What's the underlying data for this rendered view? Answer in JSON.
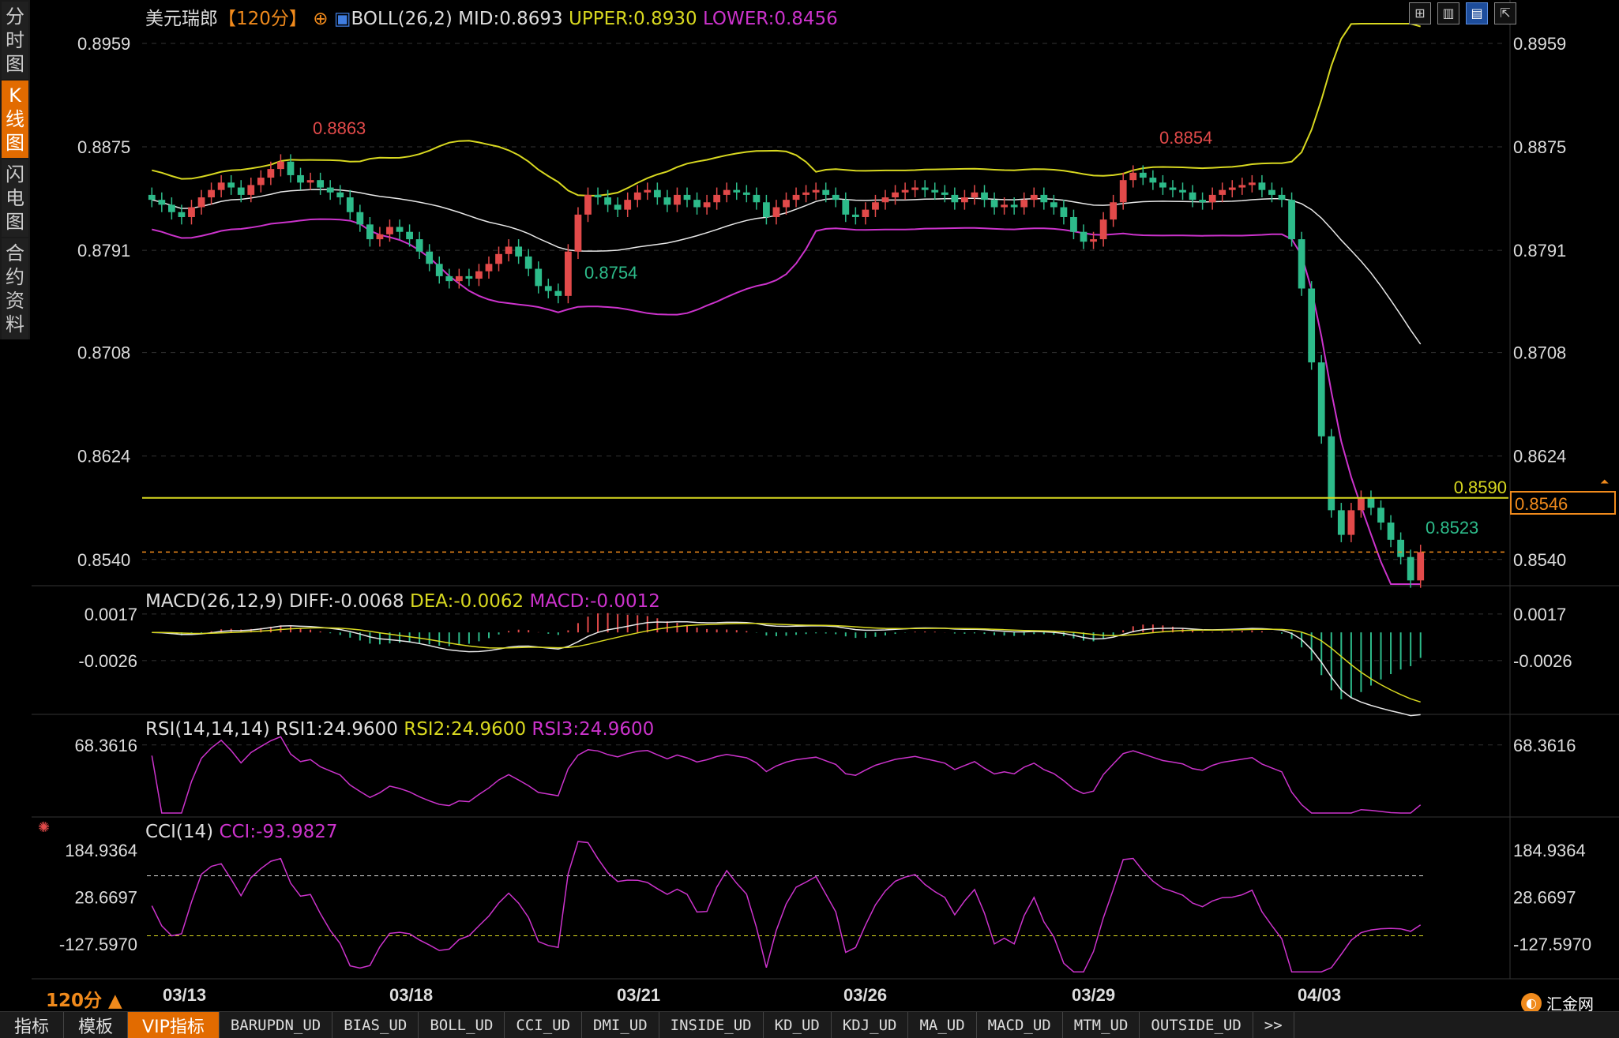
{
  "header": {
    "instrument": "美元瑞郎",
    "period_bracket": "【120分】",
    "indicator_main": "BOLL(26,2)",
    "mid": "MID:0.8693",
    "upper": "UPPER:0.8930",
    "lower": "LOWER:0.8456"
  },
  "sidebar_tabs": [
    "分时图",
    "K线图",
    "闪电图",
    "合约资料"
  ],
  "sidebar_active": 1,
  "toolbar_icons": [
    "grid-icon",
    "bar-chart-icon",
    "candle-icon",
    "expand-icon"
  ],
  "price_axis": {
    "ticks": [
      "0.8959",
      "0.8875",
      "0.8791",
      "0.8708",
      "0.8624",
      "0.8540"
    ],
    "range": [
      0.852,
      0.8975
    ],
    "current_price": "0.8546",
    "line_label": "0.8590"
  },
  "annotations": {
    "high1": "0.8863",
    "high2": "0.8854",
    "low1": "0.8754",
    "low2": "0.8523"
  },
  "macd": {
    "label": "MACD(26,12,9)",
    "diff": "DIFF:-0.0068",
    "dea": "DEA:-0.0062",
    "macd": "MACD:-0.0012",
    "ticks": [
      "0.0017",
      "-0.0026"
    ]
  },
  "rsi": {
    "label": "RSI(14,14,14)",
    "rsi1": "RSI1:24.9600",
    "rsi2": "RSI2:24.9600",
    "rsi3": "RSI3:24.9600",
    "ticks": [
      "68.3616"
    ]
  },
  "cci": {
    "label": "CCI(14)",
    "value": "CCI:-93.9827",
    "ticks": [
      "184.9364",
      "28.6697",
      "-127.5970"
    ]
  },
  "dates": [
    "03/13",
    "03/18",
    "03/21",
    "03/26",
    "03/29",
    "04/03"
  ],
  "period_label": "120分",
  "bottom_tabs": [
    "指标",
    "模板",
    "VIP指标",
    "BARUPDN_UD",
    "BIAS_UD",
    "BOLL_UD",
    "CCI_UD",
    "DMI_UD",
    "INSIDE_UD",
    "KD_UD",
    "KDJ_UD",
    "MA_UD",
    "MACD_UD",
    "MTM_UD",
    "OUTSIDE_UD",
    ">>"
  ],
  "bottom_active": 2,
  "logo_text": "汇金网",
  "colors": {
    "up": "#e24a4a",
    "down": "#2dbb8a",
    "upper": "#d8d820",
    "lower": "#cc33cc",
    "mid": "#e8e8e8",
    "accent": "#f08a1c"
  },
  "chart_data": {
    "type": "candlestick",
    "close_series": [
      0.8832,
      0.8828,
      0.8822,
      0.8818,
      0.8826,
      0.8834,
      0.884,
      0.8846,
      0.8842,
      0.8836,
      0.8844,
      0.885,
      0.8857,
      0.8863,
      0.8852,
      0.8846,
      0.8848,
      0.8842,
      0.8838,
      0.8834,
      0.8822,
      0.8812,
      0.88,
      0.8804,
      0.881,
      0.8806,
      0.88,
      0.879,
      0.878,
      0.877,
      0.8766,
      0.877,
      0.8768,
      0.8774,
      0.878,
      0.8788,
      0.8794,
      0.8786,
      0.8776,
      0.8762,
      0.8758,
      0.8754,
      0.879,
      0.882,
      0.8836,
      0.8834,
      0.8828,
      0.8824,
      0.8832,
      0.8838,
      0.884,
      0.8834,
      0.8828,
      0.8836,
      0.8832,
      0.8826,
      0.883,
      0.8836,
      0.884,
      0.8838,
      0.8836,
      0.883,
      0.8818,
      0.8826,
      0.8832,
      0.8836,
      0.8838,
      0.884,
      0.8836,
      0.8832,
      0.882,
      0.8818,
      0.8824,
      0.883,
      0.8834,
      0.8838,
      0.884,
      0.8842,
      0.884,
      0.8838,
      0.8836,
      0.883,
      0.8834,
      0.8838,
      0.8832,
      0.8826,
      0.8828,
      0.8826,
      0.8832,
      0.8836,
      0.883,
      0.8826,
      0.8818,
      0.8806,
      0.8798,
      0.88,
      0.8816,
      0.883,
      0.8848,
      0.8854,
      0.885,
      0.8846,
      0.8842,
      0.884,
      0.8838,
      0.8832,
      0.883,
      0.8836,
      0.884,
      0.8842,
      0.8844,
      0.8846,
      0.884,
      0.8836,
      0.8832,
      0.88,
      0.876,
      0.87,
      0.864,
      0.858,
      0.856,
      0.858,
      0.859,
      0.8582,
      0.857,
      0.8556,
      0.8542,
      0.8523,
      0.8546
    ],
    "x_labels": [
      "03/13",
      "03/18",
      "03/21",
      "03/26",
      "03/29",
      "04/03"
    ],
    "boll": {
      "mid": "0.8693",
      "upper": "0.8930",
      "lower": "0.8456"
    },
    "horizontal_line": 0.859,
    "current": 0.8546,
    "macd_range": [
      -0.0072,
      0.003
    ],
    "cci_levels": [
      100,
      -100
    ]
  }
}
